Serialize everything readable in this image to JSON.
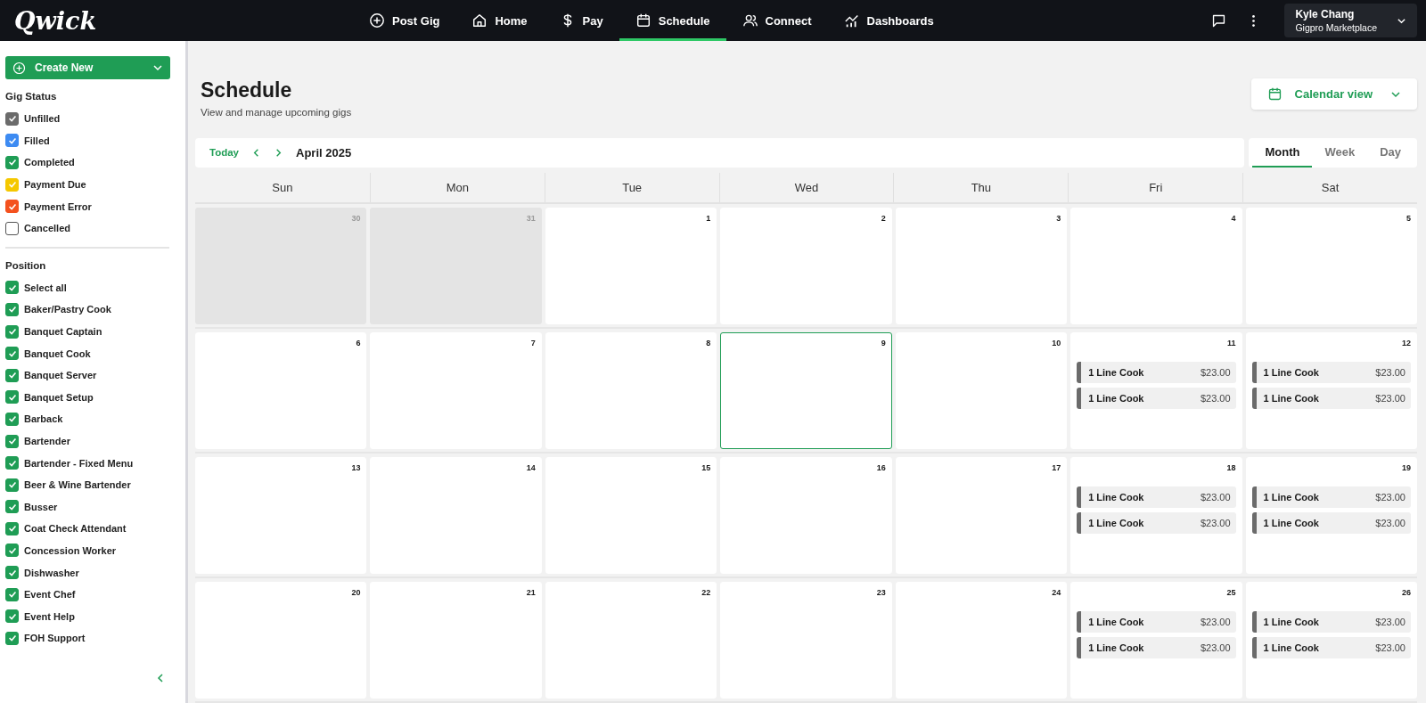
{
  "brand": {
    "logo": "Qwick"
  },
  "nav": [
    {
      "label": "Post Gig",
      "selected": false
    },
    {
      "label": "Home",
      "selected": false
    },
    {
      "label": "Pay",
      "selected": false
    },
    {
      "label": "Schedule",
      "selected": true
    },
    {
      "label": "Connect",
      "selected": false
    },
    {
      "label": "Dashboards",
      "selected": false
    }
  ],
  "account": {
    "name": "Kyle Chang",
    "company": "Gigpro Marketplace"
  },
  "sidebar": {
    "create_button": "Create New",
    "gig_status": {
      "title": "Gig Status",
      "items": [
        {
          "label": "Unfilled",
          "checked": true,
          "color": "#6b6b6b"
        },
        {
          "label": "Filled",
          "checked": true,
          "color": "#3d8bf2"
        },
        {
          "label": "Completed",
          "checked": true,
          "color": "#1f9d55"
        },
        {
          "label": "Payment Due",
          "checked": true,
          "color": "#f5c800"
        },
        {
          "label": "Payment Error",
          "checked": true,
          "color": "#f4511e"
        },
        {
          "label": "Cancelled",
          "checked": false
        }
      ]
    },
    "position": {
      "title": "Position",
      "items": [
        {
          "label": "Select all",
          "checked": true
        },
        {
          "label": "Baker/Pastry Cook",
          "checked": true
        },
        {
          "label": "Banquet Captain",
          "checked": true
        },
        {
          "label": "Banquet Cook",
          "checked": true
        },
        {
          "label": "Banquet Server",
          "checked": true
        },
        {
          "label": "Banquet Setup",
          "checked": true
        },
        {
          "label": "Barback",
          "checked": true
        },
        {
          "label": "Bartender",
          "checked": true
        },
        {
          "label": "Bartender - Fixed Menu",
          "checked": true
        },
        {
          "label": "Beer & Wine Bartender",
          "checked": true
        },
        {
          "label": "Busser",
          "checked": true
        },
        {
          "label": "Coat Check Attendant",
          "checked": true
        },
        {
          "label": "Concession Worker",
          "checked": true
        },
        {
          "label": "Dishwasher",
          "checked": true
        },
        {
          "label": "Event Chef",
          "checked": true
        },
        {
          "label": "Event Help",
          "checked": true
        },
        {
          "label": "FOH Support",
          "checked": true
        }
      ]
    }
  },
  "page": {
    "title": "Schedule",
    "subtitle": "View and manage upcoming gigs",
    "view_button": "Calendar view"
  },
  "toolbar": {
    "today": "Today",
    "month_label": "April 2025"
  },
  "view_tabs": [
    {
      "label": "Month",
      "selected": true
    },
    {
      "label": "Week",
      "selected": false
    },
    {
      "label": "Day",
      "selected": false
    }
  ],
  "weekdays": [
    "Sun",
    "Mon",
    "Tue",
    "Wed",
    "Thu",
    "Fri",
    "Sat"
  ],
  "weeks": [
    [
      {
        "label": "30",
        "outside": true,
        "selected": false
      },
      {
        "label": "31",
        "outside": true,
        "selected": false
      },
      {
        "label": "1",
        "outside": false,
        "selected": false
      },
      {
        "label": "2",
        "outside": false,
        "selected": false
      },
      {
        "label": "3",
        "outside": false,
        "selected": false
      },
      {
        "label": "4",
        "outside": false,
        "selected": false
      },
      {
        "label": "5",
        "outside": false,
        "selected": false
      }
    ],
    [
      {
        "label": "6",
        "outside": false,
        "selected": false
      },
      {
        "label": "7",
        "outside": false,
        "selected": false
      },
      {
        "label": "8",
        "outside": false,
        "selected": false
      },
      {
        "label": "9",
        "outside": false,
        "selected": true
      },
      {
        "label": "10",
        "outside": false,
        "selected": false
      },
      {
        "label": "11",
        "outside": false,
        "selected": false,
        "gigs": [
          {
            "title": "1 Line Cook",
            "price": "$23.00"
          },
          {
            "title": "1 Line Cook",
            "price": "$23.00"
          }
        ]
      },
      {
        "label": "12",
        "outside": false,
        "selected": false,
        "gigs": [
          {
            "title": "1 Line Cook",
            "price": "$23.00"
          },
          {
            "title": "1 Line Cook",
            "price": "$23.00"
          }
        ]
      }
    ],
    [
      {
        "label": "13",
        "outside": false,
        "selected": false
      },
      {
        "label": "14",
        "outside": false,
        "selected": false
      },
      {
        "label": "15",
        "outside": false,
        "selected": false
      },
      {
        "label": "16",
        "outside": false,
        "selected": false
      },
      {
        "label": "17",
        "outside": false,
        "selected": false
      },
      {
        "label": "18",
        "outside": false,
        "selected": false,
        "gigs": [
          {
            "title": "1 Line Cook",
            "price": "$23.00"
          },
          {
            "title": "1 Line Cook",
            "price": "$23.00"
          }
        ]
      },
      {
        "label": "19",
        "outside": false,
        "selected": false,
        "gigs": [
          {
            "title": "1 Line Cook",
            "price": "$23.00"
          },
          {
            "title": "1 Line Cook",
            "price": "$23.00"
          }
        ]
      }
    ],
    [
      {
        "label": "20",
        "outside": false,
        "selected": false
      },
      {
        "label": "21",
        "outside": false,
        "selected": false
      },
      {
        "label": "22",
        "outside": false,
        "selected": false
      },
      {
        "label": "23",
        "outside": false,
        "selected": false
      },
      {
        "label": "24",
        "outside": false,
        "selected": false
      },
      {
        "label": "25",
        "outside": false,
        "selected": false,
        "gigs": [
          {
            "title": "1 Line Cook",
            "price": "$23.00"
          },
          {
            "title": "1 Line Cook",
            "price": "$23.00"
          }
        ]
      },
      {
        "label": "26",
        "outside": false,
        "selected": false,
        "gigs": [
          {
            "title": "1 Line Cook",
            "price": "$23.00"
          },
          {
            "title": "1 Line Cook",
            "price": "$23.00"
          }
        ]
      }
    ]
  ]
}
